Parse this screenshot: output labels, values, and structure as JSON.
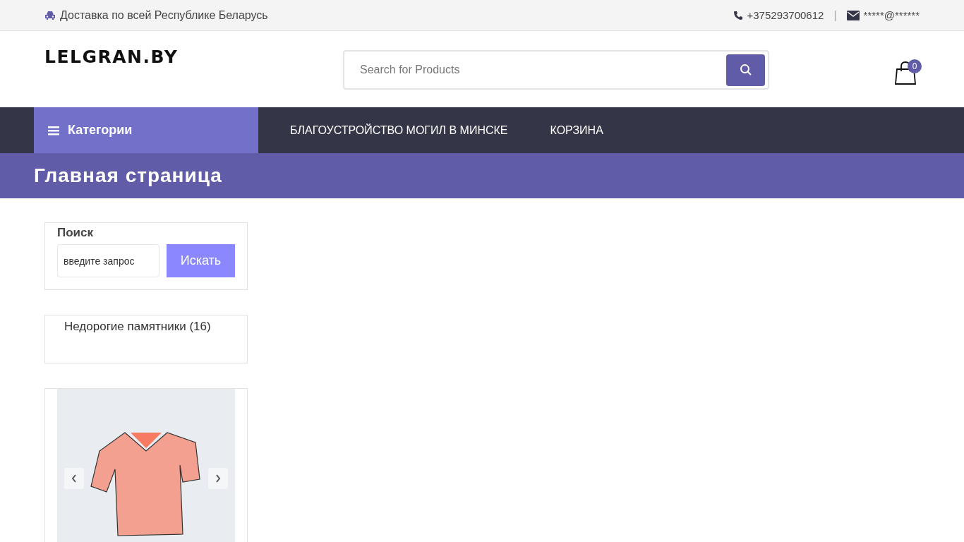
{
  "top_bar": {
    "delivery": "Доставка по всей Республике Беларусь",
    "phone": "+375293700612",
    "separator": "|",
    "email": "*****@******"
  },
  "header": {
    "logo": "LELGRAN.BY",
    "search": {
      "placeholder": "Search for Products"
    },
    "cart_count": "0"
  },
  "nav": {
    "categories": "Категории",
    "links": [
      "БЛАГОУСТРОЙСТВО МОГИЛ В МИНСКЕ",
      "КОРЗИНА"
    ]
  },
  "page_title": "Главная страница",
  "sidebar": {
    "search_widget": {
      "title": "Поиск",
      "value": "введите запрос",
      "button": "Искать"
    },
    "categories": [
      "Недорогие памятники (16)"
    ]
  }
}
